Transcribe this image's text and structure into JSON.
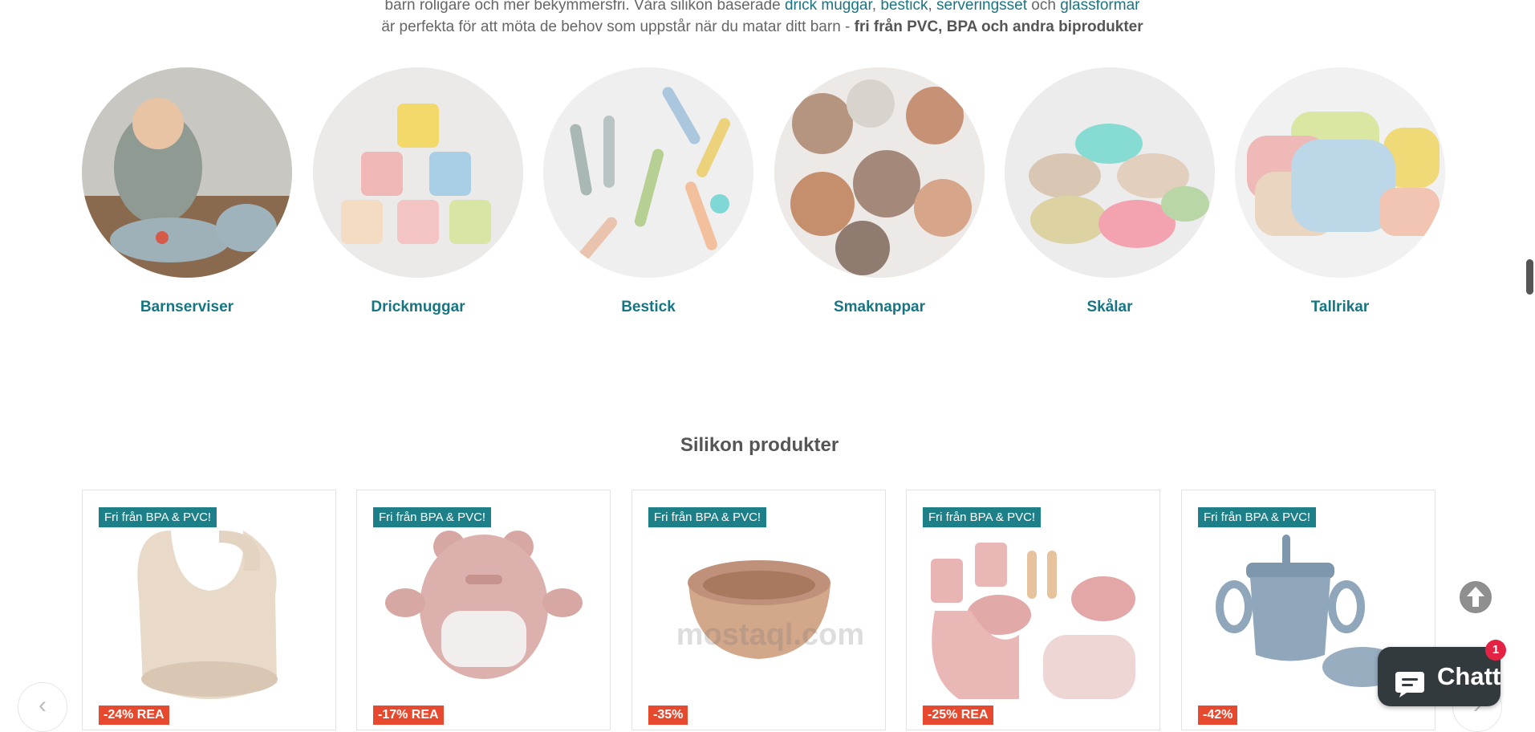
{
  "intro": {
    "line1_prefix": "barn roligare och mer bekymmersfri. Våra silikon baserade ",
    "link_cups": "drick muggar",
    "sep1": ", ",
    "link_cutlery": "bestick",
    "sep2": ", ",
    "link_sets": "serveringsset",
    "sep3": " och ",
    "link_glass": "glassformar",
    "line2_prefix": "är perfekta för att möta de behov som uppstår när du matar ditt barn - ",
    "line2_bold": "fri från PVC, BPA och andra biprodukter"
  },
  "categories": [
    {
      "label": "Barnserviser",
      "icon": "baby-eating-photo"
    },
    {
      "label": "Drickmuggar",
      "icon": "cups-photo"
    },
    {
      "label": "Bestick",
      "icon": "cutlery-photo"
    },
    {
      "label": "Smaknappar",
      "icon": "feeders-photo"
    },
    {
      "label": "Skålar",
      "icon": "bowls-photo"
    },
    {
      "label": "Tallrikar",
      "icon": "plates-photo"
    }
  ],
  "section_title": "Silikon produkter",
  "products": [
    {
      "badge": "Fri från BPA & PVC!",
      "sale": "-24% REA",
      "icon": "bib-photo"
    },
    {
      "badge": "Fri från BPA & PVC!",
      "sale": "-17% REA",
      "icon": "teether-photo"
    },
    {
      "badge": "Fri från BPA & PVC!",
      "sale": "-35%",
      "icon": "bowl-photo"
    },
    {
      "badge": "Fri från BPA & PVC!",
      "sale": "-25% REA",
      "icon": "feeding-set-photo"
    },
    {
      "badge": "Fri från BPA & PVC!",
      "sale": "-42%",
      "icon": "sippy-cup-photo"
    }
  ],
  "nav": {
    "prev": "‹",
    "next": "›"
  },
  "chat": {
    "label": "Chatt",
    "count": "1"
  },
  "watermark": "mostaql.com",
  "colors": {
    "link": "#177582",
    "badge": "#1d7f87",
    "sale": "#e7492e",
    "chat": "#333a3e",
    "chat_badge": "#e42344"
  }
}
